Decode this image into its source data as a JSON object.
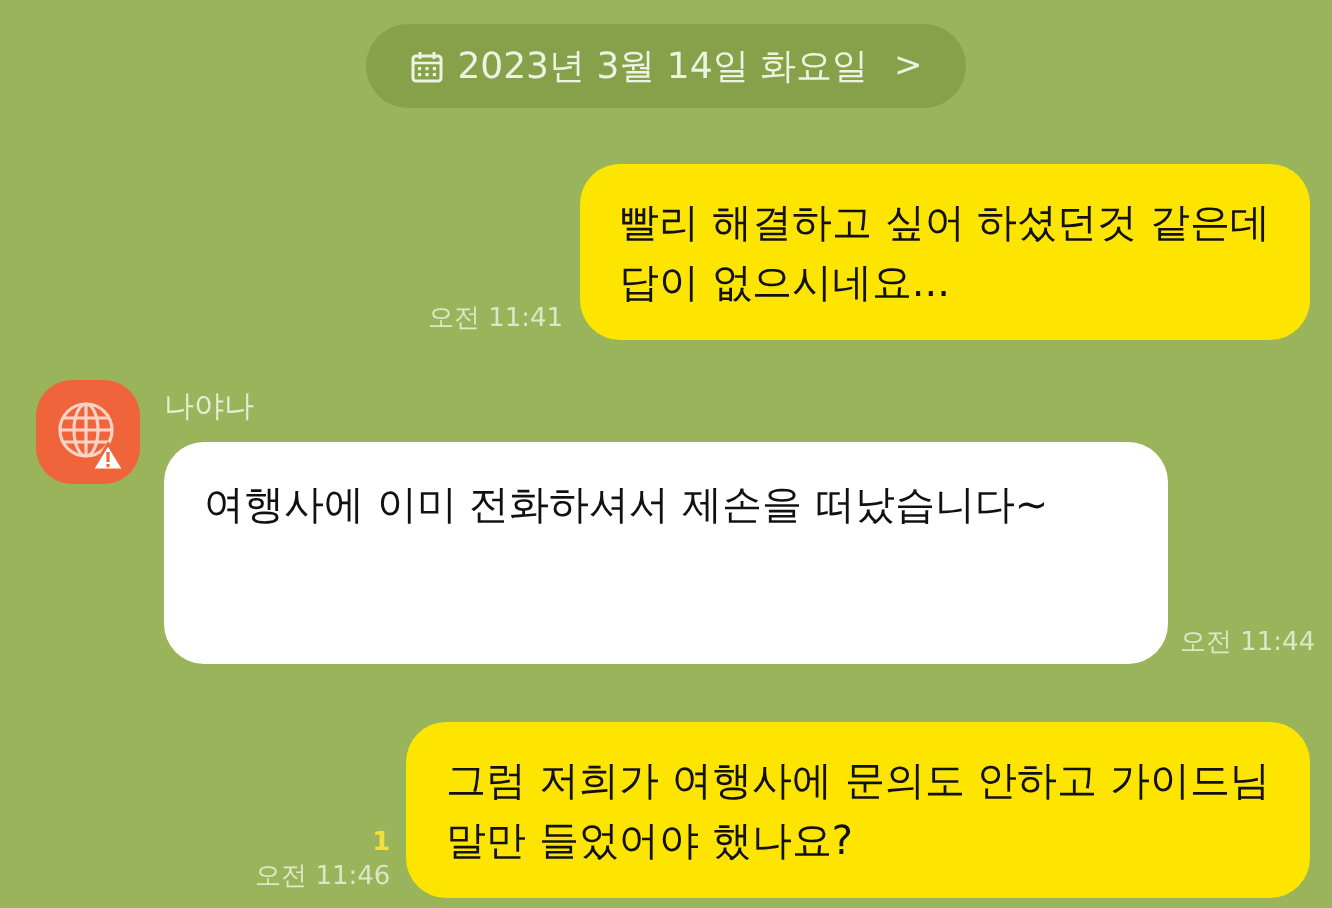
{
  "date_divider": {
    "label": "2023년 3월 14일 화요일",
    "chevron": ">"
  },
  "messages": [
    {
      "kind": "sent",
      "text": "빨리 해결하고 싶어 하셨던것 같은데\n답이 없으시네요...",
      "time": "오전 11:41"
    },
    {
      "kind": "received",
      "sender": "나야나",
      "text": "여행사에 이미 전화하셔서 제손을 떠났습니다~",
      "time": "오전 11:44"
    },
    {
      "kind": "sent",
      "text": "그럼 저희가 여행사에 문의도 안하고 가이드님\n말만 들었어야 했나요?",
      "time": "오전 11:46",
      "unread": "1"
    }
  ]
}
